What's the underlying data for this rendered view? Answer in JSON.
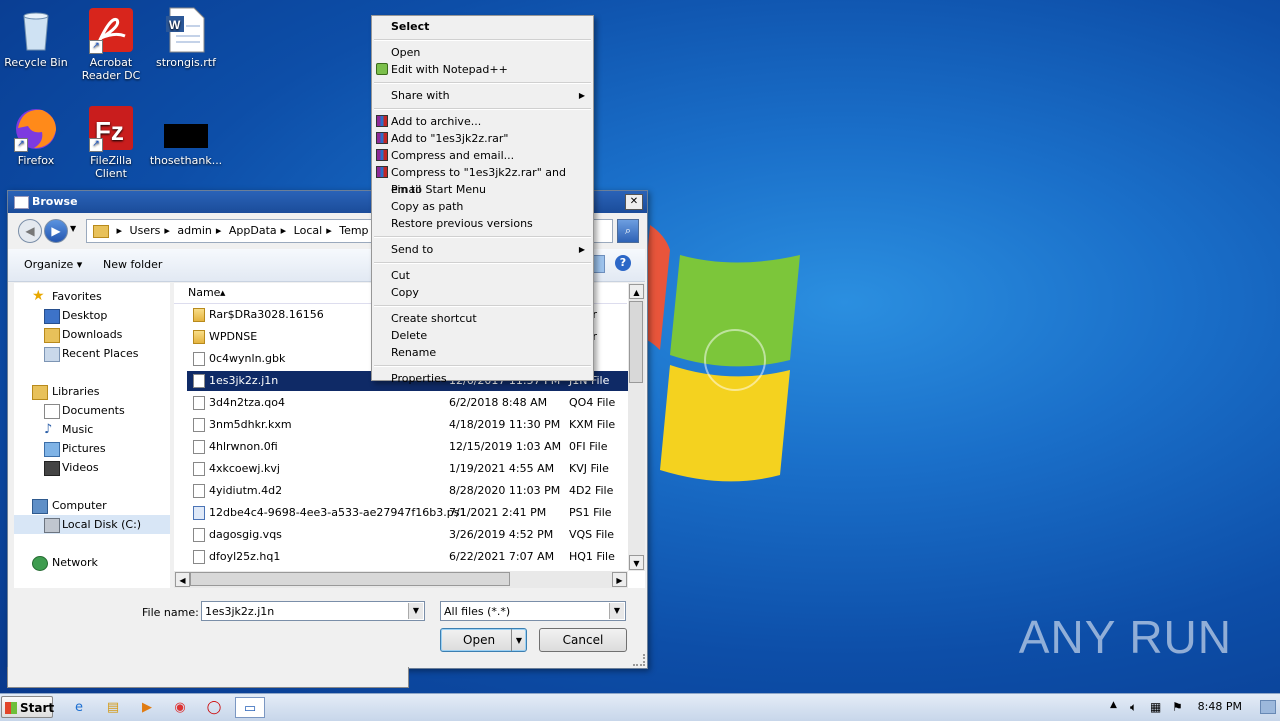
{
  "desktop": {
    "icons": [
      {
        "label": "Recycle Bin"
      },
      {
        "label": "Acrobat Reader DC"
      },
      {
        "label": "strongis.rtf"
      },
      {
        "label": "Firefox"
      },
      {
        "label": "FileZilla Client"
      },
      {
        "label": "thosethank..."
      }
    ],
    "watermark": "ANY RUN"
  },
  "dialog": {
    "title": "Browse",
    "close_glyph": "✕",
    "breadcrumb": [
      "Users",
      "admin",
      "AppData",
      "Local",
      "Temp"
    ],
    "toolbar": {
      "organize": "Organize",
      "new_folder": "New folder",
      "help": "?"
    },
    "nav": {
      "favorites": "Favorites",
      "desktop": "Desktop",
      "downloads": "Downloads",
      "recent": "Recent Places",
      "libraries": "Libraries",
      "documents": "Documents",
      "music": "Music",
      "pictures": "Pictures",
      "videos": "Videos",
      "computer": "Computer",
      "local_disk": "Local Disk (C:)",
      "network": "Network"
    },
    "columns": {
      "name": "Name"
    },
    "files": [
      {
        "name": "Rar$DRa3028.16156",
        "date": "",
        "type": "older",
        "kind": "folder"
      },
      {
        "name": "WPDNSE",
        "date": "",
        "type": "older",
        "kind": "folder"
      },
      {
        "name": "0c4wynln.gbk",
        "date": "",
        "type": "File",
        "kind": "doc"
      },
      {
        "name": "1es3jk2z.j1n",
        "date": "12/6/2017 11:57 PM",
        "type": "J1N File",
        "kind": "doc",
        "selected": true
      },
      {
        "name": "3d4n2tza.qo4",
        "date": "6/2/2018 8:48 AM",
        "type": "QO4 File",
        "kind": "doc"
      },
      {
        "name": "3nm5dhkr.kxm",
        "date": "4/18/2019 11:30 PM",
        "type": "KXM File",
        "kind": "doc"
      },
      {
        "name": "4hlrwnon.0fi",
        "date": "12/15/2019 1:03 AM",
        "type": "0FI File",
        "kind": "doc"
      },
      {
        "name": "4xkcoewj.kvj",
        "date": "1/19/2021 4:55 AM",
        "type": "KVJ File",
        "kind": "doc"
      },
      {
        "name": "4yidiutm.4d2",
        "date": "8/28/2020 11:03 PM",
        "type": "4D2 File",
        "kind": "doc"
      },
      {
        "name": "12dbe4c4-9698-4ee3-a533-ae27947f16b3.ps1",
        "date": "7/1/2021 2:41 PM",
        "type": "PS1 File",
        "kind": "ps"
      },
      {
        "name": "dagosgig.vqs",
        "date": "3/26/2019 4:52 PM",
        "type": "VQS File",
        "kind": "doc"
      },
      {
        "name": "dfoyl25z.hq1",
        "date": "6/22/2021 7:07 AM",
        "type": "HQ1 File",
        "kind": "doc"
      }
    ],
    "filename_label": "File name:",
    "filename_value": "1es3jk2z.j1n",
    "filter_value": "All files (*.*)",
    "open_button": "Open",
    "cancel_button": "Cancel"
  },
  "context_menu": {
    "items": [
      {
        "label": "Select",
        "bold": true
      },
      {
        "label": "Open"
      },
      {
        "label": "Edit with Notepad++",
        "icon": "notepadpp-icon"
      },
      {
        "label": "Share with",
        "submenu": true
      },
      {
        "label": "Add to archive...",
        "icon": "winrar-icon"
      },
      {
        "label": "Add to \"1es3jk2z.rar\"",
        "icon": "winrar-icon"
      },
      {
        "label": "Compress and email...",
        "icon": "winrar-icon"
      },
      {
        "label": "Compress to \"1es3jk2z.rar\" and email",
        "icon": "winrar-icon"
      },
      {
        "label": "Pin to Start Menu"
      },
      {
        "label": "Copy as path"
      },
      {
        "label": "Restore previous versions"
      },
      {
        "label": "Send to",
        "submenu": true
      },
      {
        "label": "Cut"
      },
      {
        "label": "Copy"
      },
      {
        "label": "Create shortcut"
      },
      {
        "label": "Delete"
      },
      {
        "label": "Rename"
      },
      {
        "label": "Properties"
      }
    ]
  },
  "taskbar": {
    "start": "Start",
    "clock": "8:48 PM"
  }
}
